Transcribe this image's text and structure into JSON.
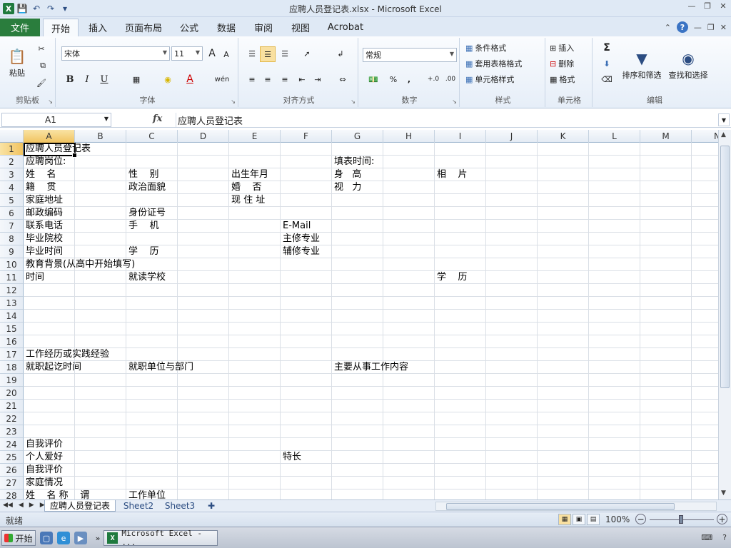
{
  "window": {
    "title": "应聘人员登记表.xlsx  -  Microsoft Excel",
    "app_icon": "X"
  },
  "ribbon_tabs": [
    "文件",
    "开始",
    "插入",
    "页面布局",
    "公式",
    "数据",
    "审阅",
    "视图",
    "Acrobat"
  ],
  "ribbon": {
    "clipboard": {
      "paste": "粘贴",
      "label": "剪贴板"
    },
    "font": {
      "name": "宋体",
      "size": "11",
      "bold": "B",
      "italic": "I",
      "underline": "U",
      "label": "字体",
      "grow": "A",
      "shrink": "A",
      "font_color": "A",
      "phonetic": "wén"
    },
    "alignment": {
      "label": "对齐方式"
    },
    "number": {
      "format": "常规",
      "percent": "%",
      "comma": ",",
      "label": "数字",
      "inc": "+.0",
      "dec": ".00"
    },
    "styles": {
      "conditional": "条件格式",
      "table": "套用表格格式",
      "cell": "单元格样式",
      "label": "样式"
    },
    "cells": {
      "insert": "插入",
      "delete": "删除",
      "format": "格式",
      "label": "单元格"
    },
    "editing": {
      "sort": "排序和筛选",
      "find": "查找和选择",
      "label": "编辑",
      "sum": "Σ"
    }
  },
  "formula_bar": {
    "name_box": "A1",
    "fx": "fx",
    "formula": "应聘人员登记表"
  },
  "columns": [
    "A",
    "B",
    "C",
    "D",
    "E",
    "F",
    "G",
    "H",
    "I",
    "J",
    "K",
    "L",
    "M",
    "N"
  ],
  "rows": [
    "1",
    "2",
    "3",
    "4",
    "5",
    "6",
    "7",
    "8",
    "9",
    "10",
    "11",
    "12",
    "13",
    "14",
    "15",
    "16",
    "17",
    "18",
    "19",
    "20",
    "21",
    "22",
    "23",
    "24",
    "25",
    "26",
    "27",
    "28"
  ],
  "cells": [
    {
      "row": 1,
      "col": 0,
      "text": "应聘人员登记表"
    },
    {
      "row": 2,
      "col": 0,
      "text": "应聘岗位:"
    },
    {
      "row": 2,
      "col": 6,
      "text": "填表时间:"
    },
    {
      "row": 3,
      "col": 0,
      "text": "姓    名"
    },
    {
      "row": 3,
      "col": 2,
      "text": "性    别"
    },
    {
      "row": 3,
      "col": 4,
      "text": "出生年月"
    },
    {
      "row": 3,
      "col": 6,
      "text": "身   高"
    },
    {
      "row": 3,
      "col": 8,
      "text": "相    片"
    },
    {
      "row": 4,
      "col": 0,
      "text": "籍    贯"
    },
    {
      "row": 4,
      "col": 2,
      "text": "政治面貌"
    },
    {
      "row": 4,
      "col": 4,
      "text": "婚    否"
    },
    {
      "row": 4,
      "col": 6,
      "text": "视   力"
    },
    {
      "row": 5,
      "col": 0,
      "text": "家庭地址"
    },
    {
      "row": 5,
      "col": 4,
      "text": "现 住 址"
    },
    {
      "row": 6,
      "col": 0,
      "text": "邮政编码"
    },
    {
      "row": 6,
      "col": 2,
      "text": "身份证号"
    },
    {
      "row": 7,
      "col": 0,
      "text": "联系电话"
    },
    {
      "row": 7,
      "col": 2,
      "text": "手    机"
    },
    {
      "row": 7,
      "col": 5,
      "text": "E-Mail"
    },
    {
      "row": 8,
      "col": 0,
      "text": "毕业院校"
    },
    {
      "row": 8,
      "col": 5,
      "text": "主修专业"
    },
    {
      "row": 9,
      "col": 0,
      "text": "毕业时间"
    },
    {
      "row": 9,
      "col": 2,
      "text": "学    历"
    },
    {
      "row": 9,
      "col": 5,
      "text": "辅修专业"
    },
    {
      "row": 10,
      "col": 0,
      "text": "教育背景(从高中开始填写)"
    },
    {
      "row": 11,
      "col": 0,
      "text": "时间"
    },
    {
      "row": 11,
      "col": 2,
      "text": "就读学校"
    },
    {
      "row": 11,
      "col": 8,
      "text": "学    历"
    },
    {
      "row": 17,
      "col": 0,
      "text": "工作经历或实践经验"
    },
    {
      "row": 18,
      "col": 0,
      "text": "就职起讫时间"
    },
    {
      "row": 18,
      "col": 2,
      "text": "就职单位与部门"
    },
    {
      "row": 18,
      "col": 6,
      "text": "主要从事工作内容"
    },
    {
      "row": 24,
      "col": 0,
      "text": "自我评价"
    },
    {
      "row": 25,
      "col": 0,
      "text": "个人爱好"
    },
    {
      "row": 25,
      "col": 5,
      "text": "特长"
    },
    {
      "row": 26,
      "col": 0,
      "text": "自我评价"
    },
    {
      "row": 27,
      "col": 0,
      "text": "家庭情况"
    },
    {
      "row": 28,
      "col": 0,
      "text": "姓    名 称    谓"
    },
    {
      "row": 28,
      "col": 2,
      "text": "工作单位"
    }
  ],
  "sheets": [
    "应聘人员登记表",
    "Sheet2",
    "Sheet3"
  ],
  "status": {
    "ready": "就绪",
    "zoom": "100%"
  },
  "taskbar": {
    "start": "开始",
    "app": "Microsoft Excel - ..."
  },
  "colors": {
    "file_tab": "#2a7d3d",
    "selection_header": "#f1c35f",
    "ribbon_bg": "#dfe9f5"
  }
}
